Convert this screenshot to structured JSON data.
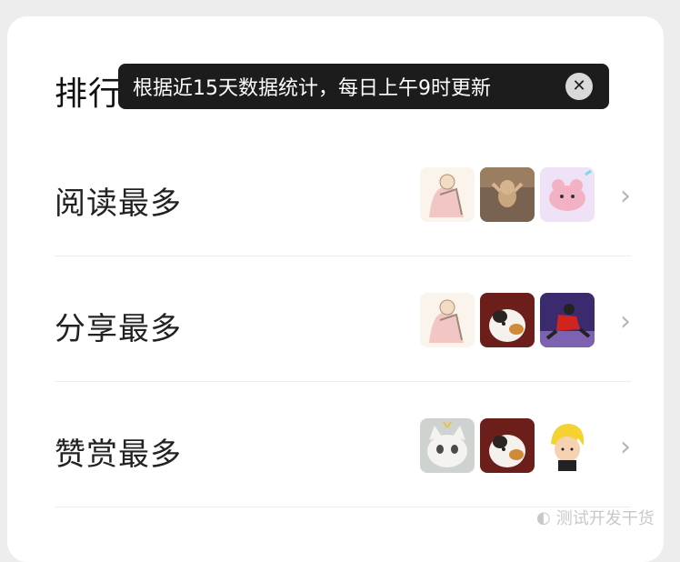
{
  "title": "排行榜",
  "tooltip": {
    "text": "根据近15天数据统计，每日上午9时更新",
    "close_icon": "close-icon"
  },
  "rows": [
    {
      "label": "阅读最多",
      "thumbs": [
        "sketch-couple",
        "cat-dancing",
        "pink-pig"
      ]
    },
    {
      "label": "分享最多",
      "thumbs": [
        "sketch-couple",
        "calico-cat",
        "skater"
      ]
    },
    {
      "label": "赞赏最多",
      "thumbs": [
        "white-cat",
        "calico-cat",
        "anime-blond"
      ]
    }
  ],
  "chevron_icon": "chevron-right-icon",
  "watermark": "测试开发干货"
}
